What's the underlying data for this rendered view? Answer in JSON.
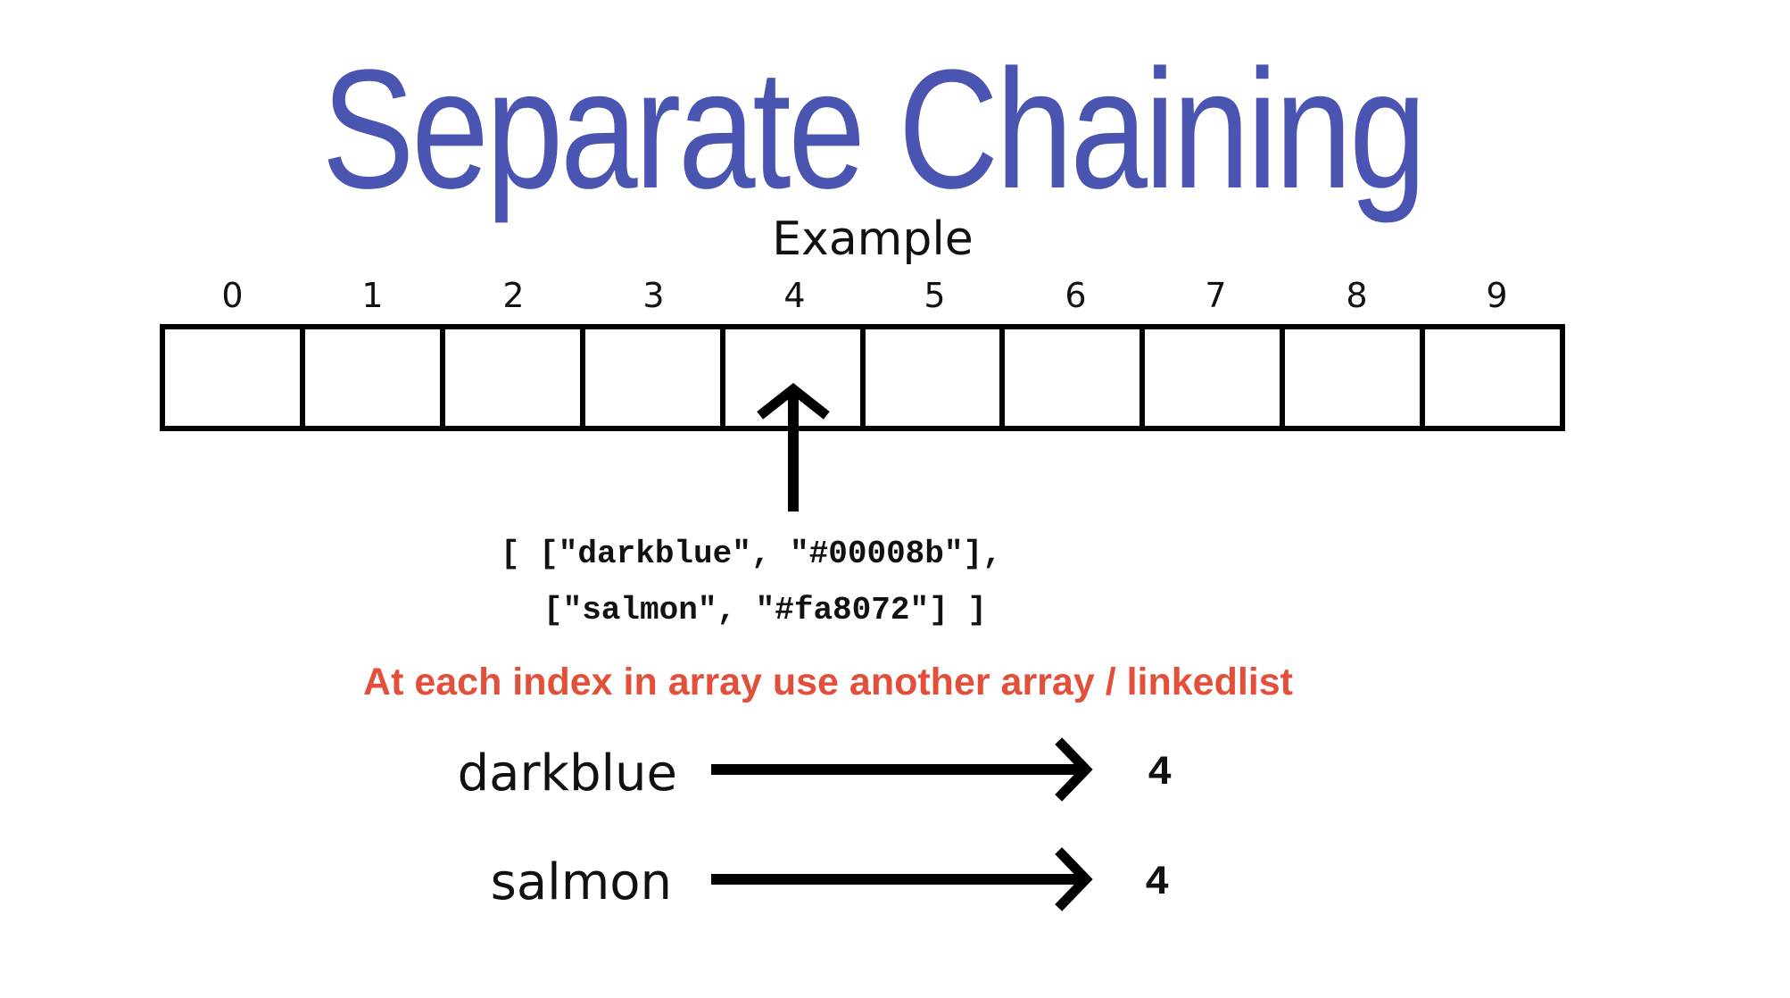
{
  "title": "Separate Chaining",
  "subtitle": "Example",
  "array": {
    "indices": [
      "0",
      "1",
      "2",
      "3",
      "4",
      "5",
      "6",
      "7",
      "8",
      "9"
    ],
    "pointer_index": 4
  },
  "bucket_contents": {
    "line1": "[ [\"darkblue\", \"#00008b\"],",
    "line2": "[\"salmon\", \"#fa8072\"] ]"
  },
  "note": "At each index in array use another array / linkedlist",
  "mappings": [
    {
      "key": "darkblue",
      "value": "4"
    },
    {
      "key": "salmon",
      "value": "4"
    }
  ],
  "colors": {
    "title": "#4a55b1",
    "note": "#e2503b",
    "ink": "#000000"
  }
}
